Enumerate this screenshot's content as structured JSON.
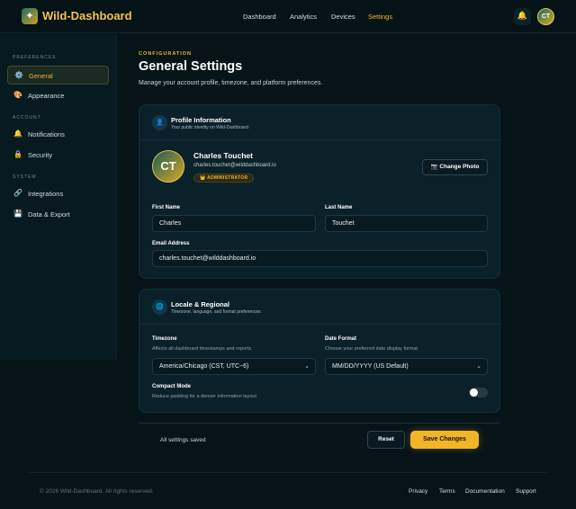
{
  "brand": {
    "name": "Wild-Dashboard",
    "logo_glyph": "✦"
  },
  "nav": {
    "links": [
      {
        "label": "Dashboard",
        "active": false
      },
      {
        "label": "Analytics",
        "active": false
      },
      {
        "label": "Devices",
        "active": false
      },
      {
        "label": "Settings",
        "active": true
      }
    ],
    "bell_icon": "🔔",
    "avatar_initials": "CT"
  },
  "sidebar": {
    "sections": [
      {
        "heading": "PREFERENCES",
        "items": [
          {
            "icon": "⚙️",
            "label": "General",
            "active": true
          },
          {
            "icon": "🎨",
            "label": "Appearance",
            "active": false
          }
        ]
      },
      {
        "heading": "ACCOUNT",
        "items": [
          {
            "icon": "🔔",
            "label": "Notifications",
            "active": false
          },
          {
            "icon": "🔒",
            "label": "Security",
            "active": false
          }
        ]
      },
      {
        "heading": "SYSTEM",
        "items": [
          {
            "icon": "🔗",
            "label": "Integrations",
            "active": false
          },
          {
            "icon": "💾",
            "label": "Data & Export",
            "active": false
          }
        ]
      }
    ]
  },
  "page": {
    "eyebrow": "CONFIGURATION",
    "title": "General Settings",
    "subtitle": "Manage your account profile, timezone, and platform preferences."
  },
  "profile_card": {
    "icon": "👤",
    "title": "Profile Information",
    "subtitle": "Your public identity on Wild-Dashboard",
    "avatar_initials": "CT",
    "name": "Charles Touchet",
    "email": "charles.touchet@wilddashboard.io",
    "badge": "👑 ADMINISTRATOR",
    "change_photo_label": "📷 Change Photo",
    "first_name_label": "First Name",
    "first_name_value": "Charles",
    "last_name_label": "Last Name",
    "last_name_value": "Touchet",
    "email_label": "Email Address",
    "email_value": "charles.touchet@wilddashboard.io"
  },
  "locale_card": {
    "icon": "🌐",
    "title": "Locale & Regional",
    "subtitle": "Timezone, language, and format preferences",
    "timezone_label": "Timezone",
    "timezone_hint": "Affects all dashboard timestamps and reports",
    "timezone_value": "America/Chicago (CST, UTC−6)",
    "date_format_label": "Date Format",
    "date_format_hint": "Choose your preferred date display format",
    "date_format_value": "MM/DD/YYYY (US Default)",
    "compact_label": "Compact Mode",
    "compact_hint": "Reduce padding for a denser information layout",
    "compact_on": false
  },
  "actions": {
    "status": "All settings saved",
    "reset_label": "Reset",
    "save_label": "Save Changes"
  },
  "footer": {
    "copyright": "© 2026 Wild-Dashboard. All rights reserved.",
    "links": [
      "Privacy",
      "Terms",
      "Documentation",
      "Support"
    ]
  },
  "colors": {
    "accent": "#f2b526",
    "background": "#061418",
    "card": "#0a2129"
  }
}
